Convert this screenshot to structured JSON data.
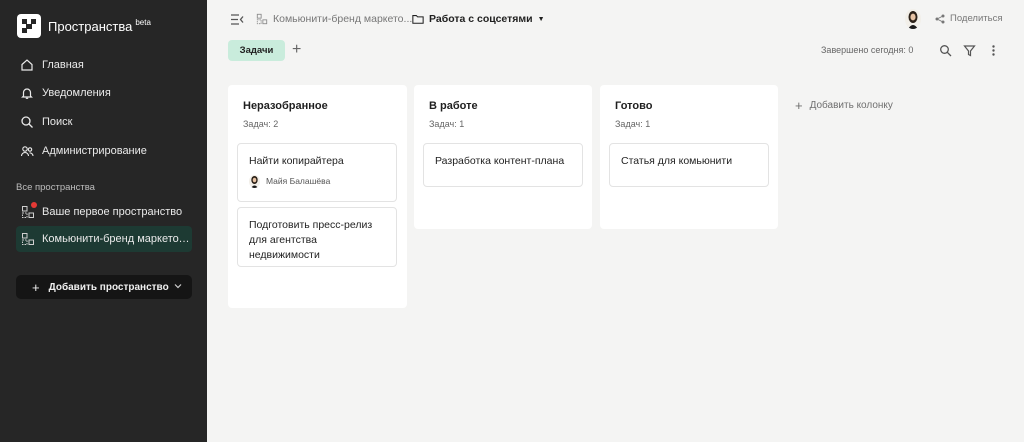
{
  "app": {
    "name": "Пространства",
    "badge": "beta"
  },
  "sidebar": {
    "nav": [
      {
        "label": "Главная",
        "icon": "home-icon"
      },
      {
        "label": "Уведомления",
        "icon": "bell-icon"
      },
      {
        "label": "Поиск",
        "icon": "search-icon"
      },
      {
        "label": "Администрирование",
        "icon": "users-icon"
      }
    ],
    "section_title": "Все пространства",
    "spaces": [
      {
        "label": "Ваше первое пространство",
        "icon": "space-icon",
        "notification": true
      },
      {
        "label": "Комьюнити-бренд маркетолог...",
        "icon": "space-icon",
        "active": true
      }
    ],
    "add_space_label": "Добавить пространство"
  },
  "topbar": {
    "breadcrumb_space": "Комьюнити-бренд маркето...",
    "breadcrumb_project": "Работа с соцсетями",
    "share_label": "Поделиться"
  },
  "toolbar": {
    "active_tab": "Задачи",
    "add_tab": "+",
    "done_today": "Завершено сегодня: 0"
  },
  "board": {
    "columns": [
      {
        "title": "Неразобранное",
        "count": "Задач: 2",
        "cards": [
          {
            "title": "Найти копирайтера",
            "assignee": "Майя Балашёва"
          },
          {
            "title": "Подготовить пресс-релиз для агентства недвижимости"
          }
        ]
      },
      {
        "title": "В работе",
        "count": "Задач: 1",
        "cards": [
          {
            "title": "Разработка контент-плана"
          }
        ]
      },
      {
        "title": "Готово",
        "count": "Задач: 1",
        "cards": [
          {
            "title": "Статья для комьюнити"
          }
        ]
      }
    ],
    "add_column_label": "Добавить колонку"
  },
  "colors": {
    "sidebar_bg": "#262626",
    "active_space_bg": "#1d3a33",
    "tab_pill_bg": "#c9ecdc",
    "notification_dot": "#e53935",
    "board_bg": "#f4f4f3"
  }
}
